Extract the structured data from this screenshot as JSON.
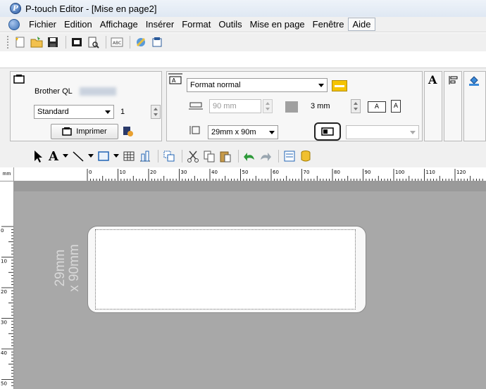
{
  "window": {
    "title": "P-touch Editor - [Mise en page2]"
  },
  "menu": [
    "Fichier",
    "Edition",
    "Affichage",
    "Insérer",
    "Format",
    "Outils",
    "Mise en page",
    "Fenêtre",
    "Aide"
  ],
  "printer_panel": {
    "printer_name": "Brother QL",
    "mode": "Standard",
    "copies": "1",
    "print_label": "Imprimer"
  },
  "page_panel": {
    "format": "Format normal",
    "length": "90 mm",
    "margin": "3 mm",
    "media": "29mm x 90m"
  },
  "ruler": {
    "unit": "mm",
    "h_labels": [
      "0",
      "10",
      "20",
      "30",
      "40",
      "50",
      "60",
      "70",
      "80",
      "90",
      "100",
      "110",
      "120"
    ],
    "v_labels": [
      "0",
      "10",
      "20",
      "30",
      "40",
      "50"
    ]
  },
  "label": {
    "size_line1": "29mm",
    "size_line2": "x 90mm"
  },
  "colors": {
    "canvas": "#a8a8a8",
    "accent": "#2c5aa0"
  }
}
